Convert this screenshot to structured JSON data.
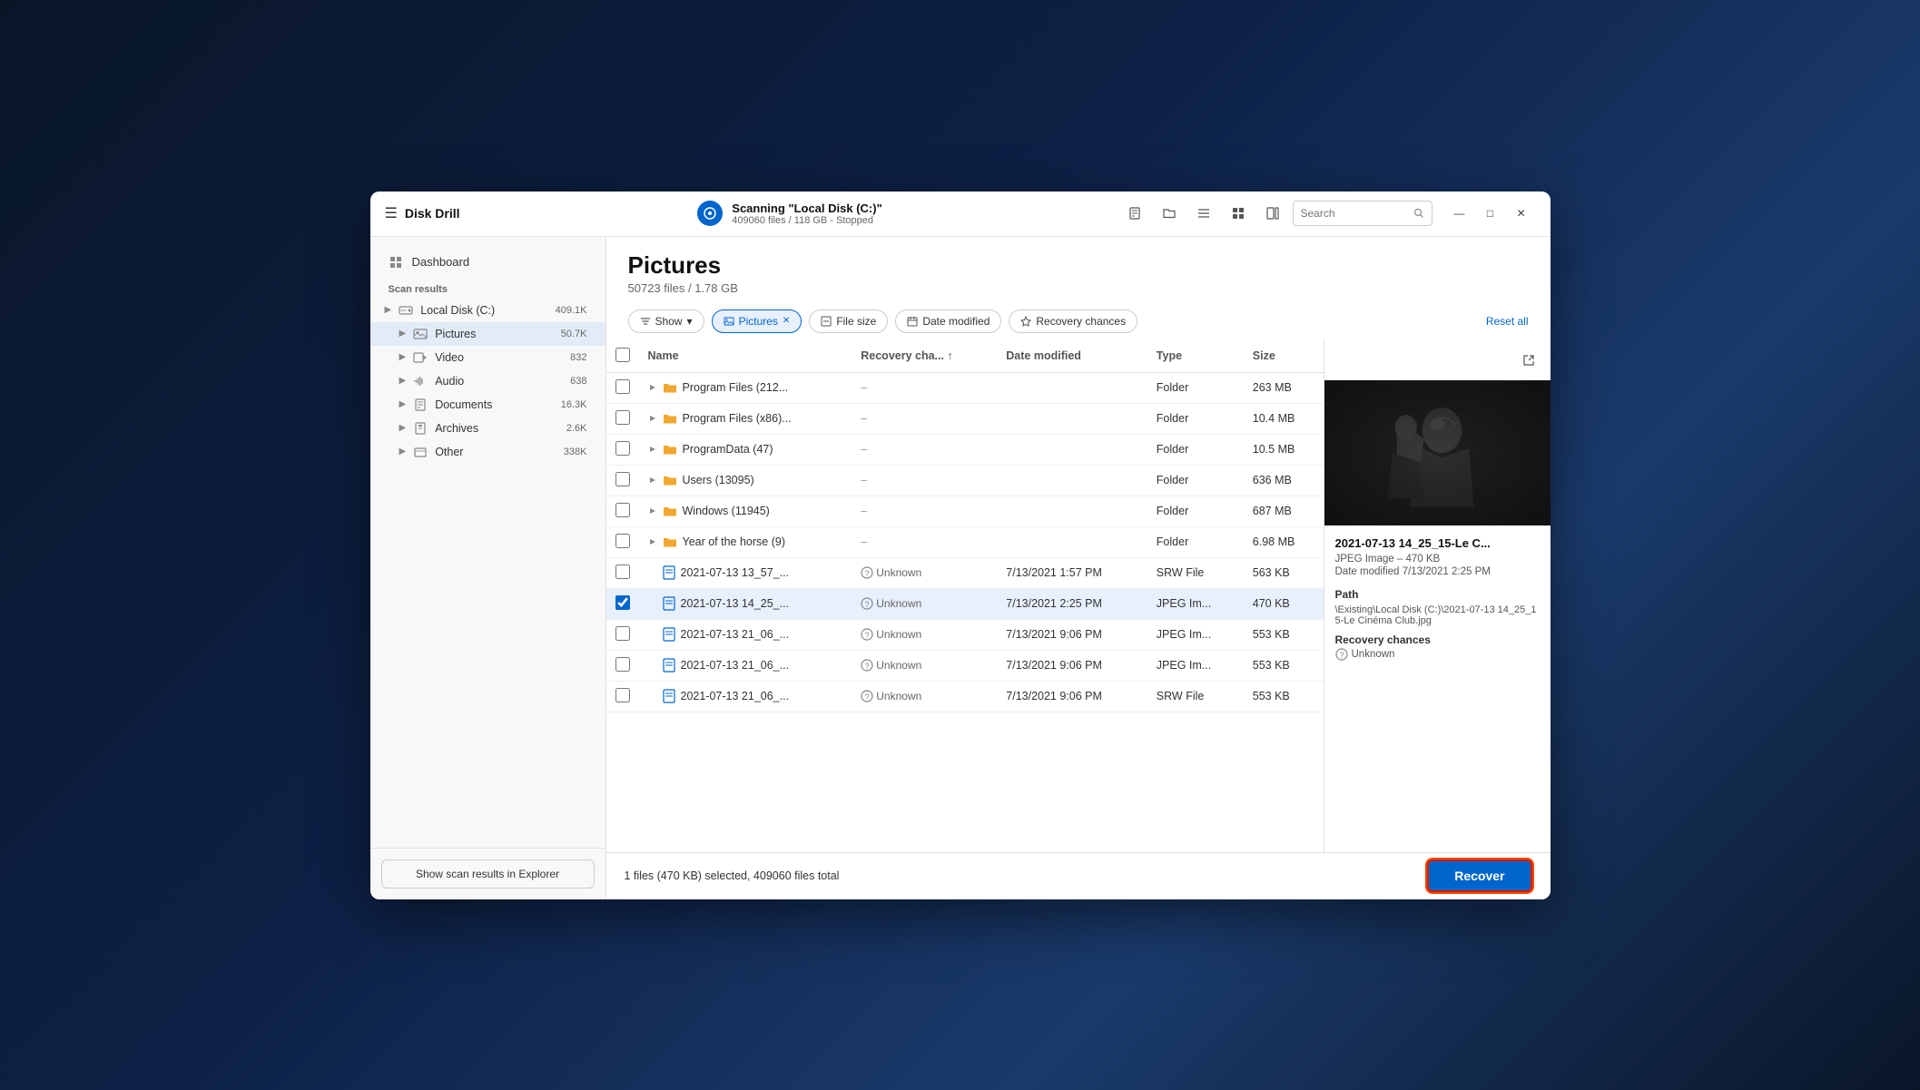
{
  "app": {
    "title": "Disk Drill",
    "hamburger": "☰",
    "scan_title": "Scanning \"Local Disk (C:)\"",
    "scan_subtitle": "409060 files / 118 GB - Stopped",
    "toolbar": {
      "doc_icon": "🗋",
      "folder_icon": "🗁",
      "list_icon": "☰",
      "grid_icon": "⊞",
      "panel_icon": "▣",
      "search_placeholder": "Search"
    },
    "window_controls": {
      "minimize": "—",
      "maximize": "□",
      "close": "✕"
    }
  },
  "sidebar": {
    "dashboard_label": "Dashboard",
    "section_label": "Scan results",
    "items": [
      {
        "id": "local-disk",
        "icon": "💾",
        "label": "Local Disk (C:)",
        "count": "409.1K",
        "active": false
      },
      {
        "id": "pictures",
        "icon": "🖼",
        "label": "Pictures",
        "count": "50.7K",
        "active": true
      },
      {
        "id": "video",
        "icon": "🎬",
        "label": "Video",
        "count": "832",
        "active": false
      },
      {
        "id": "audio",
        "icon": "🎵",
        "label": "Audio",
        "count": "638",
        "active": false
      },
      {
        "id": "documents",
        "icon": "📄",
        "label": "Documents",
        "count": "16.3K",
        "active": false
      },
      {
        "id": "archives",
        "icon": "📦",
        "label": "Archives",
        "count": "2.6K",
        "active": false
      },
      {
        "id": "other",
        "icon": "📁",
        "label": "Other",
        "count": "338K",
        "active": false
      }
    ],
    "footer_btn": "Show scan results in Explorer"
  },
  "main": {
    "title": "Pictures",
    "subtitle": "50723 files / 1.78 GB",
    "filters": {
      "show_label": "Show",
      "pictures_label": "Pictures",
      "filesize_label": "File size",
      "datemodified_label": "Date modified",
      "recoverychances_label": "Recovery chances",
      "resetall_label": "Reset all"
    },
    "table": {
      "headers": [
        "Name",
        "Recovery cha... ↑",
        "Date modified",
        "Type",
        "Size"
      ],
      "rows": [
        {
          "id": "r1",
          "type": "folder",
          "name": "Program Files (212...",
          "recovery": "–",
          "date": "",
          "filetype": "Folder",
          "size": "263 MB",
          "checked": false,
          "selected": false
        },
        {
          "id": "r2",
          "type": "folder",
          "name": "Program Files (x86)...",
          "recovery": "–",
          "date": "",
          "filetype": "Folder",
          "size": "10.4 MB",
          "checked": false,
          "selected": false
        },
        {
          "id": "r3",
          "type": "folder",
          "name": "ProgramData (47)",
          "recovery": "–",
          "date": "",
          "filetype": "Folder",
          "size": "10.5 MB",
          "checked": false,
          "selected": false
        },
        {
          "id": "r4",
          "type": "folder",
          "name": "Users (13095)",
          "recovery": "–",
          "date": "",
          "filetype": "Folder",
          "size": "636 MB",
          "checked": false,
          "selected": false
        },
        {
          "id": "r5",
          "type": "folder",
          "name": "Windows (11945)",
          "recovery": "–",
          "date": "",
          "filetype": "Folder",
          "size": "687 MB",
          "checked": false,
          "selected": false
        },
        {
          "id": "r6",
          "type": "folder",
          "name": "Year of the horse (9)",
          "recovery": "–",
          "date": "",
          "filetype": "Folder",
          "size": "6.98 MB",
          "checked": false,
          "selected": false
        },
        {
          "id": "r7",
          "type": "file",
          "name": "2021-07-13 13_57_...",
          "recovery": "Unknown",
          "date": "7/13/2021 1:57 PM",
          "filetype": "SRW File",
          "size": "563 KB",
          "checked": false,
          "selected": false
        },
        {
          "id": "r8",
          "type": "file",
          "name": "2021-07-13 14_25_...",
          "recovery": "Unknown",
          "date": "7/13/2021 2:25 PM",
          "filetype": "JPEG Im...",
          "size": "470 KB",
          "checked": true,
          "selected": true
        },
        {
          "id": "r9",
          "type": "file",
          "name": "2021-07-13 21_06_...",
          "recovery": "Unknown",
          "date": "7/13/2021 9:06 PM",
          "filetype": "JPEG Im...",
          "size": "553 KB",
          "checked": false,
          "selected": false
        },
        {
          "id": "r10",
          "type": "file",
          "name": "2021-07-13 21_06_...",
          "recovery": "Unknown",
          "date": "7/13/2021 9:06 PM",
          "filetype": "JPEG Im...",
          "size": "553 KB",
          "checked": false,
          "selected": false
        },
        {
          "id": "r11",
          "type": "file",
          "name": "2021-07-13 21_06_...",
          "recovery": "Unknown",
          "date": "7/13/2021 9:06 PM",
          "filetype": "SRW File",
          "size": "553 KB",
          "checked": false,
          "selected": false
        }
      ]
    }
  },
  "preview": {
    "filename": "2021-07-13 14_25_15-Le C...",
    "type_size": "JPEG Image – 470 KB",
    "date_modified": "Date modified 7/13/2021 2:25 PM",
    "path_label": "Path",
    "path_value": "\\Existing\\Local Disk (C:)\\2021-07-13 14_25_15-Le Cinéma Club.jpg",
    "recovery_label": "Recovery chances",
    "recovery_value": "Unknown"
  },
  "status": {
    "selected_text": "1 files (470 KB) selected, 409060 files total",
    "recover_label": "Recover"
  },
  "colors": {
    "accent": "#0066cc",
    "folder": "#f0a830",
    "selected_row": "#e8f0fe"
  }
}
